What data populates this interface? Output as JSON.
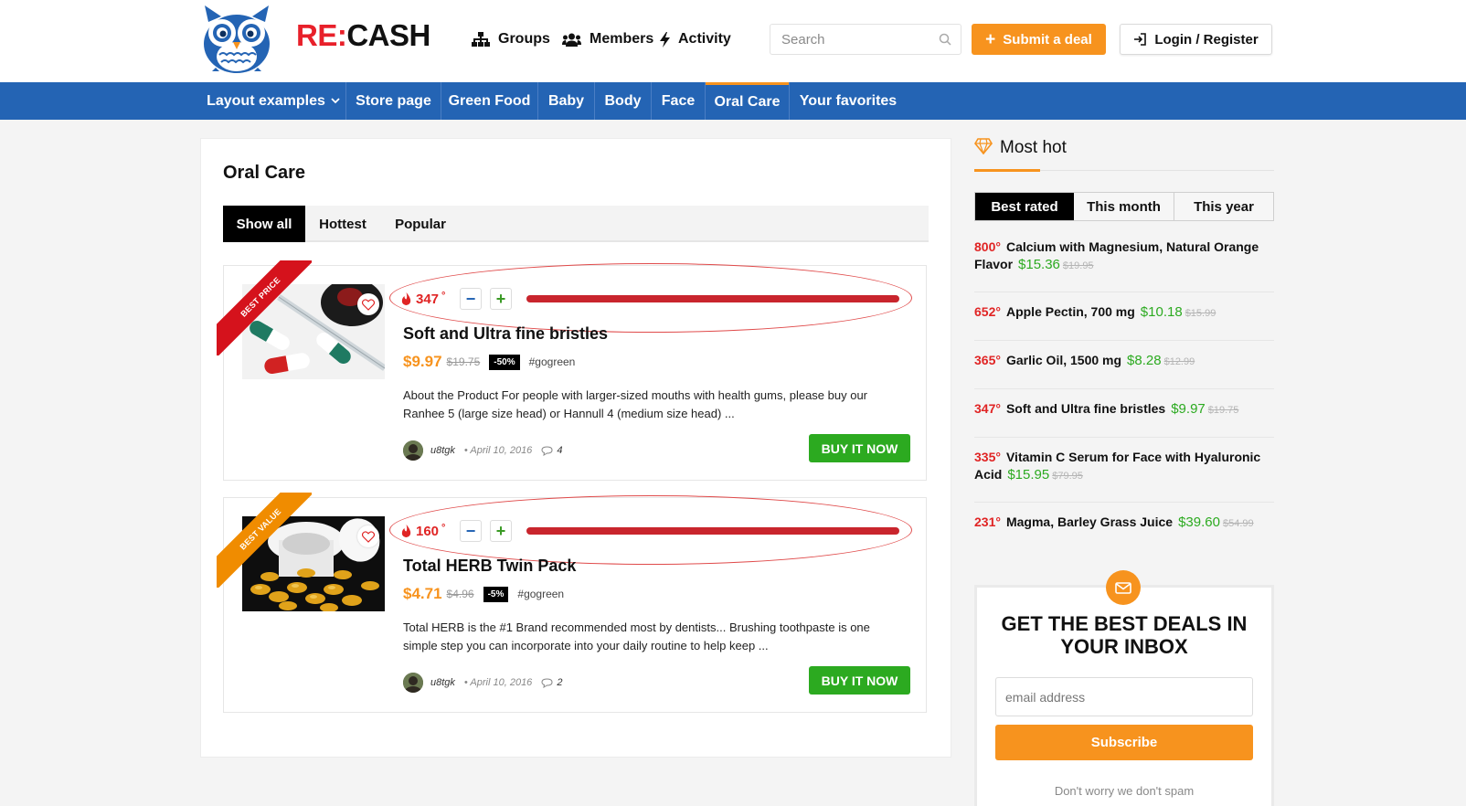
{
  "header": {
    "logo_re": "RE:",
    "logo_cash": "CASH",
    "nav": [
      "Groups",
      "Members",
      "Activity"
    ],
    "search_placeholder": "Search",
    "submit_label": "Submit a deal",
    "login_label": "Login / Register"
  },
  "category_nav": [
    "Layout examples",
    "Store page",
    "Green Food",
    "Baby",
    "Body",
    "Face",
    "Oral Care",
    "Your favorites"
  ],
  "active_category": "Oral Care",
  "main": {
    "title": "Oral Care",
    "tabs": [
      "Show all",
      "Hottest",
      "Popular"
    ],
    "active_tab": "Show all",
    "deals": [
      {
        "ribbon": "BEST PRICE",
        "ribbon_color": "#d5121c",
        "hot": "347",
        "hot_fill": 1.0,
        "title": "Soft and Ultra fine bristles",
        "price": "$9.97",
        "old_price": "$19.75",
        "discount": "-50%",
        "tag": "gogreen",
        "description": "About the Product For people with larger-sized mouths with health gums, please buy our Ranhee 5 (large size head) or Hannull 4 (medium size head) ...",
        "author": "u8tgk",
        "date": "April 10, 2016",
        "comments": "4",
        "button": "BUY IT NOW"
      },
      {
        "ribbon": "BEST VALUE",
        "ribbon_color": "#f08c00",
        "hot": "160",
        "hot_fill": 1.0,
        "title": "Total HERB Twin Pack",
        "price": "$4.71",
        "old_price": "$4.96",
        "discount": "-5%",
        "tag": "gogreen",
        "description": "Total HERB is the #1 Brand recommended most by dentists... Brushing toothpaste is one simple step you can incorporate into your daily routine to help keep ...",
        "author": "u8tgk",
        "date": "April 10, 2016",
        "comments": "2",
        "button": "BUY IT NOW"
      }
    ]
  },
  "sidebar": {
    "title": "Most hot",
    "tabs": [
      "Best rated",
      "This month",
      "This year"
    ],
    "active_tab": "Best rated",
    "hot_list": [
      {
        "deg": "800",
        "title": "Calcium with Magnesium, Natural Orange Flavor",
        "price": "$15.36",
        "old": "$19.95"
      },
      {
        "deg": "652",
        "title": "Apple Pectin, 700 mg",
        "price": "$10.18",
        "old": "$15.99"
      },
      {
        "deg": "365",
        "title": "Garlic Oil, 1500 mg",
        "price": "$8.28",
        "old": "$12.99"
      },
      {
        "deg": "347",
        "title": "Soft and Ultra fine bristles",
        "price": "$9.97",
        "old": "$19.75"
      },
      {
        "deg": "335",
        "title": "Vitamin C Serum for Face with Hyaluronic Acid",
        "price": "$15.95",
        "old": "$79.95"
      },
      {
        "deg": "231",
        "title": "Magma, Barley Grass Juice",
        "price": "$39.60",
        "old": "$54.99"
      }
    ],
    "newsletter": {
      "title": "GET THE BEST DEALS IN YOUR INBOX",
      "placeholder": "email address",
      "button": "Subscribe",
      "note": "Don't worry we don't spam"
    }
  },
  "colors": {
    "brand_blue": "#2464b4",
    "accent_orange": "#f7931e",
    "hot_red": "#e02424",
    "buy_green": "#2caa20"
  }
}
